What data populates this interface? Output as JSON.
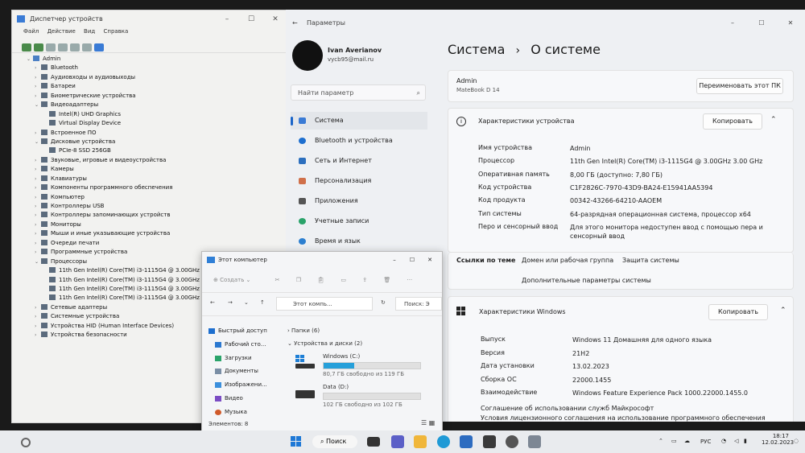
{
  "device_manager": {
    "title": "Диспетчер устройств",
    "menu": [
      "Файл",
      "Действие",
      "Вид",
      "Справка"
    ],
    "root": "Admin",
    "tree": [
      {
        "label": "Bluetooth",
        "level": 1,
        "exp": false
      },
      {
        "label": "Аудиовходы и аудиовыходы",
        "level": 1,
        "exp": false
      },
      {
        "label": "Батареи",
        "level": 1,
        "exp": false
      },
      {
        "label": "Биометрические устройства",
        "level": 1,
        "exp": false
      },
      {
        "label": "Видеоадаптеры",
        "level": 1,
        "exp": true
      },
      {
        "label": "Intel(R) UHD Graphics",
        "level": 2
      },
      {
        "label": "Virtual Display Device",
        "level": 2
      },
      {
        "label": "Встроенное ПО",
        "level": 1,
        "exp": false
      },
      {
        "label": "Дисковые устройства",
        "level": 1,
        "exp": true
      },
      {
        "label": "PCIe-8 SSD 256GB",
        "level": 2
      },
      {
        "label": "Звуковые, игровые и видеоустройства",
        "level": 1,
        "exp": false
      },
      {
        "label": "Камеры",
        "level": 1,
        "exp": false
      },
      {
        "label": "Клавиатуры",
        "level": 1,
        "exp": false
      },
      {
        "label": "Компоненты программного обеспечения",
        "level": 1,
        "exp": false
      },
      {
        "label": "Компьютер",
        "level": 1,
        "exp": false
      },
      {
        "label": "Контроллеры USB",
        "level": 1,
        "exp": false
      },
      {
        "label": "Контроллеры запоминающих устройств",
        "level": 1,
        "exp": false
      },
      {
        "label": "Мониторы",
        "level": 1,
        "exp": false
      },
      {
        "label": "Мыши и иные указывающие устройства",
        "level": 1,
        "exp": false
      },
      {
        "label": "Очереди печати",
        "level": 1,
        "exp": false
      },
      {
        "label": "Программные устройства",
        "level": 1,
        "exp": false
      },
      {
        "label": "Процессоры",
        "level": 1,
        "exp": true
      },
      {
        "label": "11th Gen Intel(R) Core(TM) i3-1115G4 @ 3.00GHz",
        "level": 2
      },
      {
        "label": "11th Gen Intel(R) Core(TM) i3-1115G4 @ 3.00GHz",
        "level": 2
      },
      {
        "label": "11th Gen Intel(R) Core(TM) i3-1115G4 @ 3.00GHz",
        "level": 2
      },
      {
        "label": "11th Gen Intel(R) Core(TM) i3-1115G4 @ 3.00GHz",
        "level": 2
      },
      {
        "label": "Сетевые адаптеры",
        "level": 1,
        "exp": false
      },
      {
        "label": "Системные устройства",
        "level": 1,
        "exp": false
      },
      {
        "label": "Устройства HID (Human Interface Devices)",
        "level": 1,
        "exp": false
      },
      {
        "label": "Устройства безопасности",
        "level": 1,
        "exp": false
      }
    ]
  },
  "settings": {
    "title": "Параметры",
    "user_name": "Ivan Averianov",
    "user_email": "vycb95@mail.ru",
    "search_placeholder": "Найти параметр",
    "nav": [
      "Система",
      "Bluetooth и устройства",
      "Сеть и Интернет",
      "Персонализация",
      "Приложения",
      "Учетные записи",
      "Время и язык"
    ],
    "breadcrumb_parent": "Система",
    "breadcrumb_sep": "›",
    "breadcrumb_current": "О системе",
    "pc_name": "Admin",
    "pc_model": "MateBook D 14",
    "rename_button": "Переименовать этот ПК",
    "device_specs_title": "Характеристики устройства",
    "copy_button": "Копировать",
    "device_specs": [
      {
        "k": "Имя устройства",
        "v": "Admin"
      },
      {
        "k": "Процессор",
        "v": "11th Gen Intel(R) Core(TM) i3-1115G4 @ 3.00GHz   3.00 GHz"
      },
      {
        "k": "Оперативная память",
        "v": "8,00 ГБ (доступно: 7,80 ГБ)"
      },
      {
        "k": "Код устройства",
        "v": "C1F2826C-7970-43D9-BA24-E15941AA5394"
      },
      {
        "k": "Код продукта",
        "v": "00342-43266-64210-AAOEM"
      },
      {
        "k": "Тип системы",
        "v": "64-разрядная операционная система, процессор x64"
      },
      {
        "k": "Перо и сенсорный ввод",
        "v": "Для этого монитора недоступен ввод с помощью пера и сенсорный ввод"
      }
    ],
    "related_label": "Ссылки по теме",
    "related_links": [
      "Домен или рабочая группа",
      "Защита системы"
    ],
    "advanced_link": "Дополнительные параметры системы",
    "windows_specs_title": "Характеристики Windows",
    "windows_specs": [
      {
        "k": "Выпуск",
        "v": "Windows 11 Домашняя для одного языка"
      },
      {
        "k": "Версия",
        "v": "21H2"
      },
      {
        "k": "Дата установки",
        "v": "13.02.2023"
      },
      {
        "k": "Сборка ОС",
        "v": "22000.1455"
      },
      {
        "k": "Взаимодействие",
        "v": "Windows Feature Experience Pack 1000.22000.1455.0"
      }
    ],
    "service_agreement": "Соглашение об использовании служб Майкрософт",
    "license_terms": "Условия лицензионного соглашения на использование программного обеспечения"
  },
  "explorer": {
    "title": "Этот компьютер",
    "create_label": "Создать",
    "address": "Этот компь...",
    "search_placeholder": "Поиск: Э",
    "quick_access": "Быстрый доступ",
    "side_items": [
      "Рабочий сто...",
      "Загрузки",
      "Документы",
      "Изображени...",
      "Видео",
      "Музыка"
    ],
    "folders_group": "Папки (6)",
    "drives_group": "Устройства и диски (2)",
    "drives": [
      {
        "name": "Windows (C:)",
        "free": "80,7 ГБ свободно из 119 ГБ",
        "used_fraction": 0.32
      },
      {
        "name": "Data (D:)",
        "free": "102 ГБ свободно из 102 ГБ",
        "used_fraction": 0.0
      }
    ],
    "status": "Элементов: 8"
  },
  "taskbar": {
    "search_label": "Поиск",
    "lang": "РУС",
    "time": "18:17",
    "date": "12.02.2023"
  },
  "colors": {
    "accent": "#1a64c8",
    "drive_fill": "#26a0da"
  }
}
